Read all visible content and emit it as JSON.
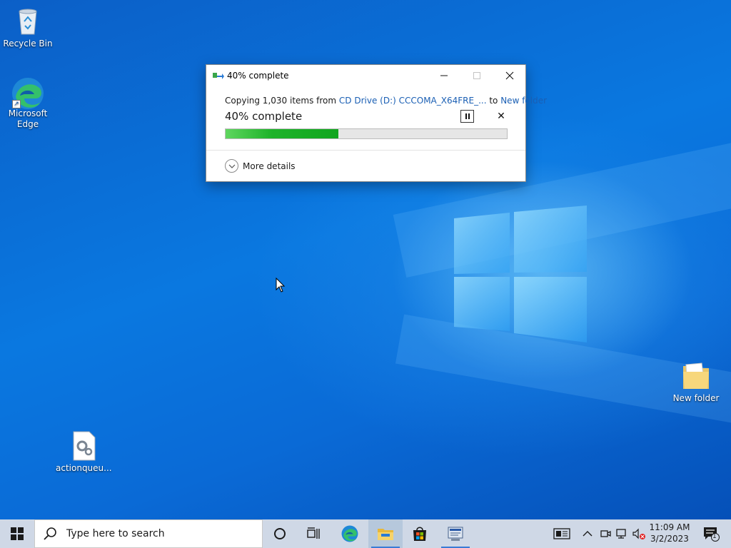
{
  "desktop": {
    "icons": [
      {
        "label": "Recycle Bin",
        "icon": "recycle-bin-icon"
      },
      {
        "label": "Microsoft Edge",
        "icon": "edge-icon"
      },
      {
        "label": "actionqueu...",
        "icon": "settings-file-icon"
      },
      {
        "label": "New folder",
        "icon": "folder-icon"
      }
    ]
  },
  "dialog": {
    "title": "40% complete",
    "copy_prefix": "Copying 1,030 items from ",
    "source": "CD Drive (D:) CCCOMA_X64FRE_...",
    "copy_mid": " to ",
    "destination": "New folder",
    "percent_label": "40% complete",
    "progress": 0.4,
    "more_details": "More details",
    "progress_color": "#12a51f",
    "link_color": "#1a5fb4"
  },
  "taskbar": {
    "search_placeholder": "Type here to search",
    "apps": [
      "cortana-icon",
      "task-view-icon",
      "edge-icon",
      "file-explorer-icon",
      "store-icon",
      "setup-app-icon"
    ],
    "tray": [
      "news-icon",
      "chevron-up-icon",
      "meet-now-icon",
      "network-icon",
      "volume-muted-icon"
    ],
    "time": "11:09 AM",
    "date": "3/2/2023",
    "notification_count": "1"
  }
}
